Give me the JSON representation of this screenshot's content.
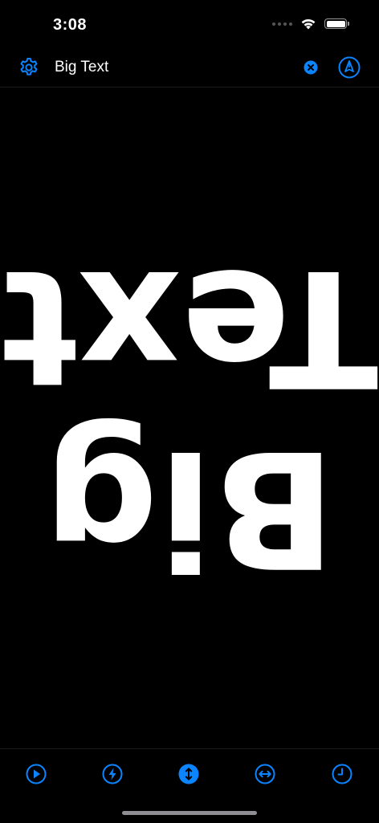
{
  "status_bar": {
    "time": "3:08"
  },
  "nav": {
    "title": "Big Text",
    "settings_icon": "gear-icon",
    "clear_icon": "clear-circle-icon",
    "edit_icon": "pen-nib-icon"
  },
  "display": {
    "lines": [
      "Big",
      "Text"
    ],
    "orientation": "rotated-180",
    "text_color": "#ffffff",
    "background_color": "#000000"
  },
  "toolbar": {
    "items": [
      {
        "icon": "play-circle-icon",
        "active": false
      },
      {
        "icon": "bolt-circle-icon",
        "active": false
      },
      {
        "icon": "flip-vertical-circle-icon",
        "active": true
      },
      {
        "icon": "flip-horizontal-circle-icon",
        "active": false
      },
      {
        "icon": "clock-icon",
        "active": false
      }
    ]
  },
  "colors": {
    "accent": "#0a84ff"
  }
}
